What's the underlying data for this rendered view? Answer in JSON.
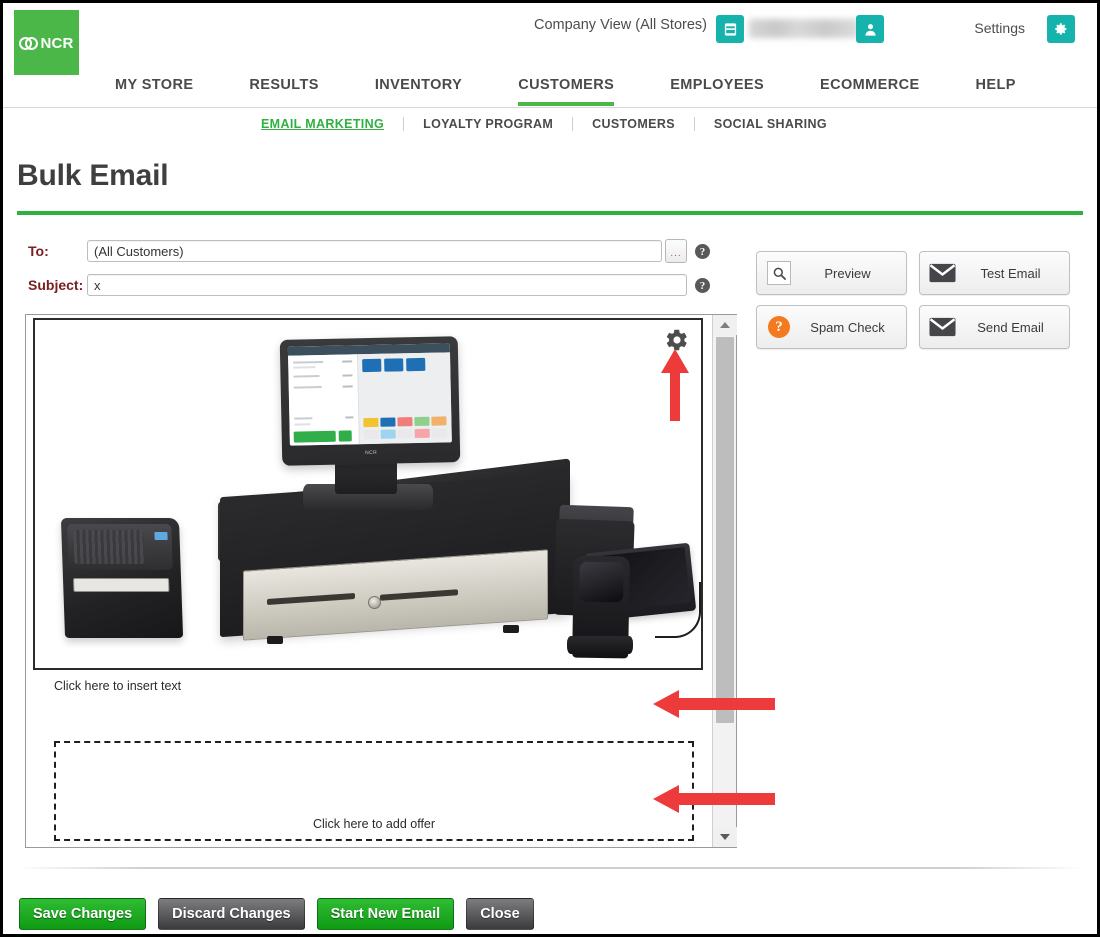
{
  "header": {
    "logo_text": "NCR",
    "company_view": "Company View (All Stores)",
    "store_name_redacted": "",
    "settings_label": "Settings",
    "icons": {
      "store": "store-icon",
      "user": "user-icon",
      "gear": "gear-icon"
    }
  },
  "mainnav": {
    "items": [
      {
        "label": "MY STORE",
        "active": false
      },
      {
        "label": "RESULTS",
        "active": false
      },
      {
        "label": "INVENTORY",
        "active": false
      },
      {
        "label": "CUSTOMERS",
        "active": true
      },
      {
        "label": "EMPLOYEES",
        "active": false
      },
      {
        "label": "ECOMMERCE",
        "active": false
      },
      {
        "label": "HELP",
        "active": false
      }
    ]
  },
  "subnav": {
    "items": [
      {
        "label": "EMAIL MARKETING",
        "active": true
      },
      {
        "label": "LOYALTY PROGRAM",
        "active": false
      },
      {
        "label": "CUSTOMERS",
        "active": false
      },
      {
        "label": "SOCIAL SHARING",
        "active": false
      }
    ]
  },
  "page": {
    "title": "Bulk Email"
  },
  "form": {
    "to_label": "To:",
    "to_value": "(All Customers)",
    "to_placeholder": "(All Customers)",
    "browse_label": "...",
    "subject_label": "Subject:",
    "subject_value": "x",
    "subject_placeholder": "",
    "help_glyph": "?"
  },
  "actions": [
    {
      "label": "Preview",
      "icon": "magnifier-icon"
    },
    {
      "label": "Test Email",
      "icon": "envelope-icon"
    },
    {
      "label": "Spam Check",
      "icon": "question-circle-icon"
    },
    {
      "label": "Send Email",
      "icon": "envelope-icon"
    }
  ],
  "editor": {
    "image_alt": "NCR point-of-sale hardware: touchscreen terminal, cash drawer, receipt printer, payment pin pad, tablet and barcode scanner",
    "gear_icon": "gear-icon",
    "insert_text_placeholder": "Click here to insert text",
    "add_offer_placeholder": "Click here to add offer",
    "scrollbar": {
      "up_arrow": "triangle-up-icon",
      "down_arrow": "triangle-down-icon"
    }
  },
  "annotations": [
    {
      "name": "arrow-up-to-gear",
      "direction": "up",
      "color": "#ed3a3a"
    },
    {
      "name": "arrow-left-to-text-area",
      "direction": "left",
      "color": "#ed3a3a"
    },
    {
      "name": "arrow-left-to-offer-area",
      "direction": "left",
      "color": "#ed3a3a"
    }
  ],
  "footer": {
    "buttons": [
      {
        "label": "Save Changes",
        "style": "green"
      },
      {
        "label": "Discard Changes",
        "style": "gray"
      },
      {
        "label": "Start New Email",
        "style": "green"
      },
      {
        "label": "Close",
        "style": "gray"
      }
    ]
  },
  "colors": {
    "brand_green": "#4cb749",
    "accent_teal": "#16b3ad",
    "active_green": "#2fb141",
    "annotation_red": "#ed3a3a",
    "label_maroon": "#7a2020",
    "spam_orange": "#f47a20"
  }
}
